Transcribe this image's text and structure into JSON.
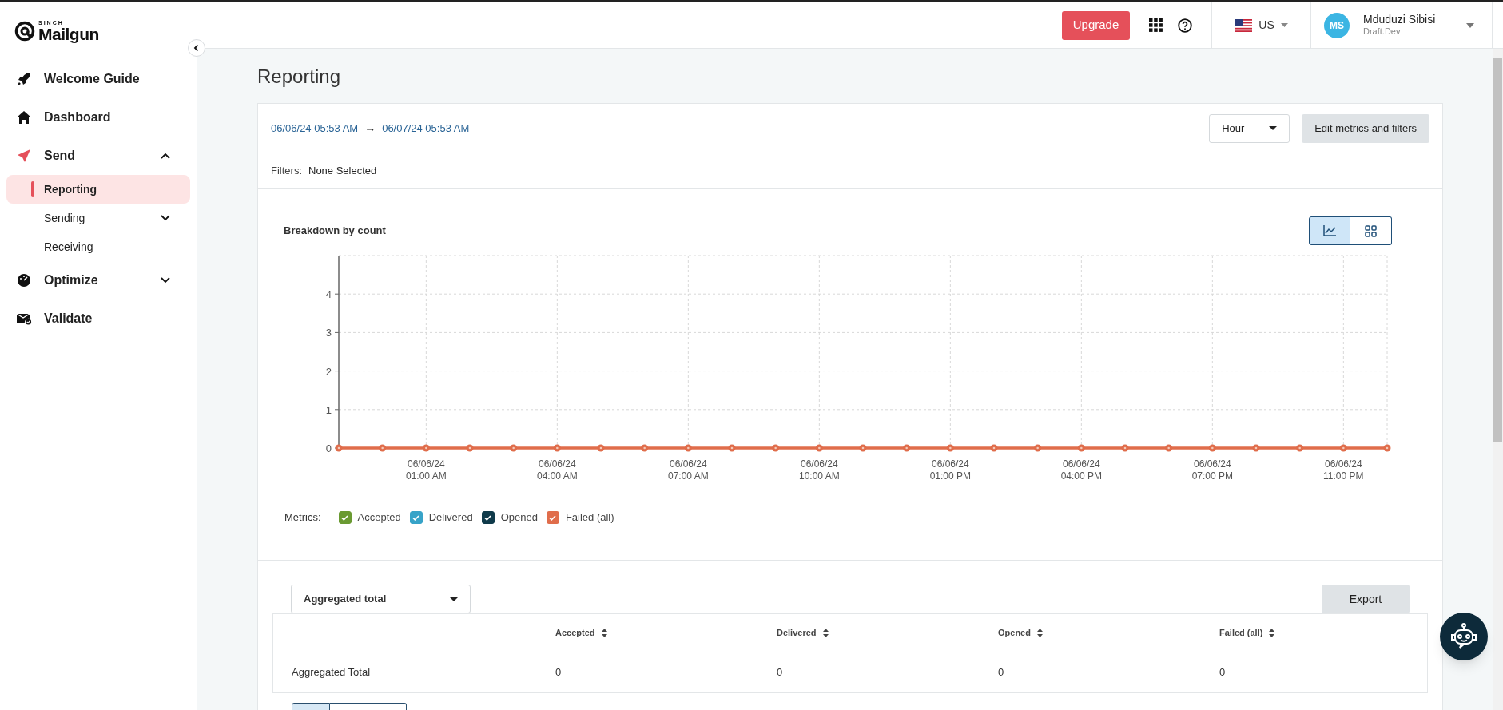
{
  "brand": {
    "small": "SINCH",
    "name": "Mailgun"
  },
  "sidebar": {
    "items": [
      {
        "label": "Welcome Guide",
        "selected": false
      },
      {
        "label": "Dashboard",
        "selected": false
      },
      {
        "label": "Send",
        "selected": false,
        "expanded": true,
        "children": [
          {
            "label": "Reporting",
            "selected": true
          },
          {
            "label": "Sending",
            "selected": false,
            "expanded": false
          },
          {
            "label": "Receiving",
            "selected": false
          }
        ]
      },
      {
        "label": "Optimize",
        "selected": false,
        "expanded": false
      },
      {
        "label": "Validate",
        "selected": false
      }
    ]
  },
  "header": {
    "upgrade": "Upgrade",
    "region": "US",
    "user": {
      "initials": "MS",
      "name": "Mduduzi Sibisi",
      "org": "Draft.Dev"
    }
  },
  "page": {
    "title": "Reporting"
  },
  "range": {
    "start": "06/06/24 05:53 AM",
    "arrow": "→",
    "end": "06/07/24 05:53 AM",
    "interval": "Hour",
    "edit_button": "Edit metrics and filters"
  },
  "filters": {
    "label": "Filters:",
    "value": "None Selected"
  },
  "chart": {
    "view_toggle": [
      {
        "kind": "line",
        "selected": true
      },
      {
        "kind": "grid",
        "selected": false
      }
    ],
    "chart_data": {
      "type": "line",
      "title": "Breakdown by count",
      "categories": [
        null,
        null,
        "06/06/24 01:00 AM",
        null,
        null,
        "06/06/24 04:00 AM",
        null,
        null,
        "06/06/24 07:00 AM",
        null,
        null,
        "06/06/24 10:00 AM",
        null,
        null,
        "06/06/24 01:00 PM",
        null,
        null,
        "06/06/24 04:00 PM",
        null,
        null,
        "06/06/24 07:00 PM",
        null,
        null,
        "06/06/24 11:00 PM",
        null
      ],
      "series": [
        {
          "name": "Accepted",
          "color": "#6a9a32",
          "values": [
            null,
            null,
            null,
            null,
            null,
            null,
            null,
            null,
            null,
            null,
            null,
            null,
            null,
            null,
            null,
            null,
            null,
            null,
            null,
            null,
            null,
            null,
            null,
            null,
            null
          ]
        },
        {
          "name": "Delivered",
          "color": "#37a3c8",
          "values": [
            null,
            null,
            null,
            null,
            null,
            null,
            null,
            null,
            null,
            null,
            null,
            null,
            null,
            null,
            null,
            null,
            null,
            null,
            null,
            null,
            null,
            null,
            null,
            null,
            null
          ]
        },
        {
          "name": "Opened",
          "color": "#0f3a4a",
          "values": [
            null,
            null,
            null,
            null,
            null,
            null,
            null,
            null,
            null,
            null,
            null,
            null,
            null,
            null,
            null,
            null,
            null,
            null,
            null,
            null,
            null,
            null,
            null,
            null,
            null
          ]
        },
        {
          "name": "Failed (all)",
          "color": "#e06d4b",
          "marker": true,
          "values": [
            0,
            0,
            0,
            0,
            0,
            0,
            0,
            0,
            0,
            0,
            0,
            0,
            0,
            0,
            0,
            0,
            0,
            0,
            0,
            0,
            0,
            0,
            0,
            0,
            0
          ]
        }
      ],
      "ylim": [
        0,
        5
      ],
      "yticks": [
        0,
        1,
        2,
        3,
        4
      ],
      "grid": true
    },
    "metrics_label": "Metrics:",
    "metrics": [
      {
        "checked": true
      },
      {
        "checked": true
      },
      {
        "checked": true
      },
      {
        "checked": true
      }
    ]
  },
  "table_controls": {
    "grouping": "Aggregated total",
    "export": "Export"
  },
  "table": {
    "columns": [
      "Accepted",
      "Delivered",
      "Opened",
      "Failed (all)"
    ],
    "rows": [
      {
        "label": "Aggregated Total",
        "cells": [
          "0",
          "0",
          "0",
          "0"
        ]
      }
    ]
  }
}
